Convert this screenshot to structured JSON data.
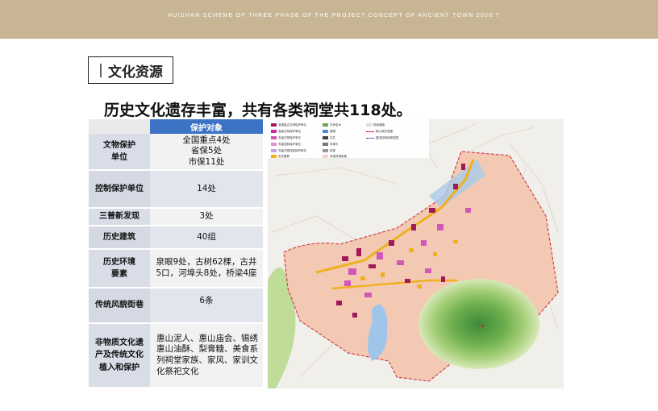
{
  "header": {
    "text": "HUISHAN SCHEME OF THREE PHASE OF THE PROJECT CONCEPT OF ANCIENT TOWN    2020.7"
  },
  "section": {
    "bar": "|",
    "title": "文化资源"
  },
  "headline": "历史文化遗存丰富，共有各类祠堂共118处。",
  "table": {
    "header": "保护对象",
    "rows": [
      {
        "label": "文物保护单位",
        "value": "全国重点4处\n省保5处\n市保11处"
      },
      {
        "label": "控制保护单位",
        "value": "14处"
      },
      {
        "label": "三普新发现",
        "value": "3处"
      },
      {
        "label": "历史建筑",
        "value": "40组"
      },
      {
        "label": "历史环境要素",
        "value": "泉眼9处，古树62棵，古井5口，河埠头8处，桥梁4座"
      },
      {
        "label": "传统风貌街巷",
        "value": "6条"
      },
      {
        "label": "非物质文化遗产及传统文化植入和保护",
        "value": "惠山泥人、惠山庙会、锡绣惠山油酥、梨膏糖、美食系列祠堂家族、家风、家训文化祭祀文化"
      }
    ]
  },
  "map": {
    "legend": [
      {
        "label": "全国重点文物保护单位",
        "color": "#a0195a",
        "kind": "swatch"
      },
      {
        "label": "省级文物保护单位",
        "color": "#c0309a",
        "kind": "swatch"
      },
      {
        "label": "市级文物保护单位",
        "color": "#d058b8",
        "kind": "swatch"
      },
      {
        "label": "市级控制保护单位",
        "color": "#e090d0",
        "kind": "swatch"
      },
      {
        "label": "市级文物控制保护单位",
        "color": "#c9a0e0",
        "kind": "swatch"
      },
      {
        "label": "历史建筑",
        "color": "#f0b020",
        "kind": "swatch"
      },
      {
        "label": "古树名木",
        "color": "#6aa84f",
        "kind": "swatch"
      },
      {
        "label": "泉眼",
        "color": "#4a90d9",
        "kind": "swatch"
      },
      {
        "label": "古井",
        "color": "#444444",
        "kind": "swatch"
      },
      {
        "label": "河埠头",
        "color": "#777777",
        "kind": "swatch"
      },
      {
        "label": "桥梁",
        "color": "#999999",
        "kind": "swatch"
      },
      {
        "label": "传统风貌街巷",
        "color": "#f6d5c4",
        "kind": "swatch"
      },
      {
        "label": "规划道路",
        "color": "#dddddd",
        "kind": "swatch"
      },
      {
        "label": "核心保护范围",
        "color": "#c8002a",
        "kind": "dash"
      },
      {
        "label": "建设控制地带范围",
        "color": "#445ba8",
        "kind": "dash"
      }
    ]
  }
}
